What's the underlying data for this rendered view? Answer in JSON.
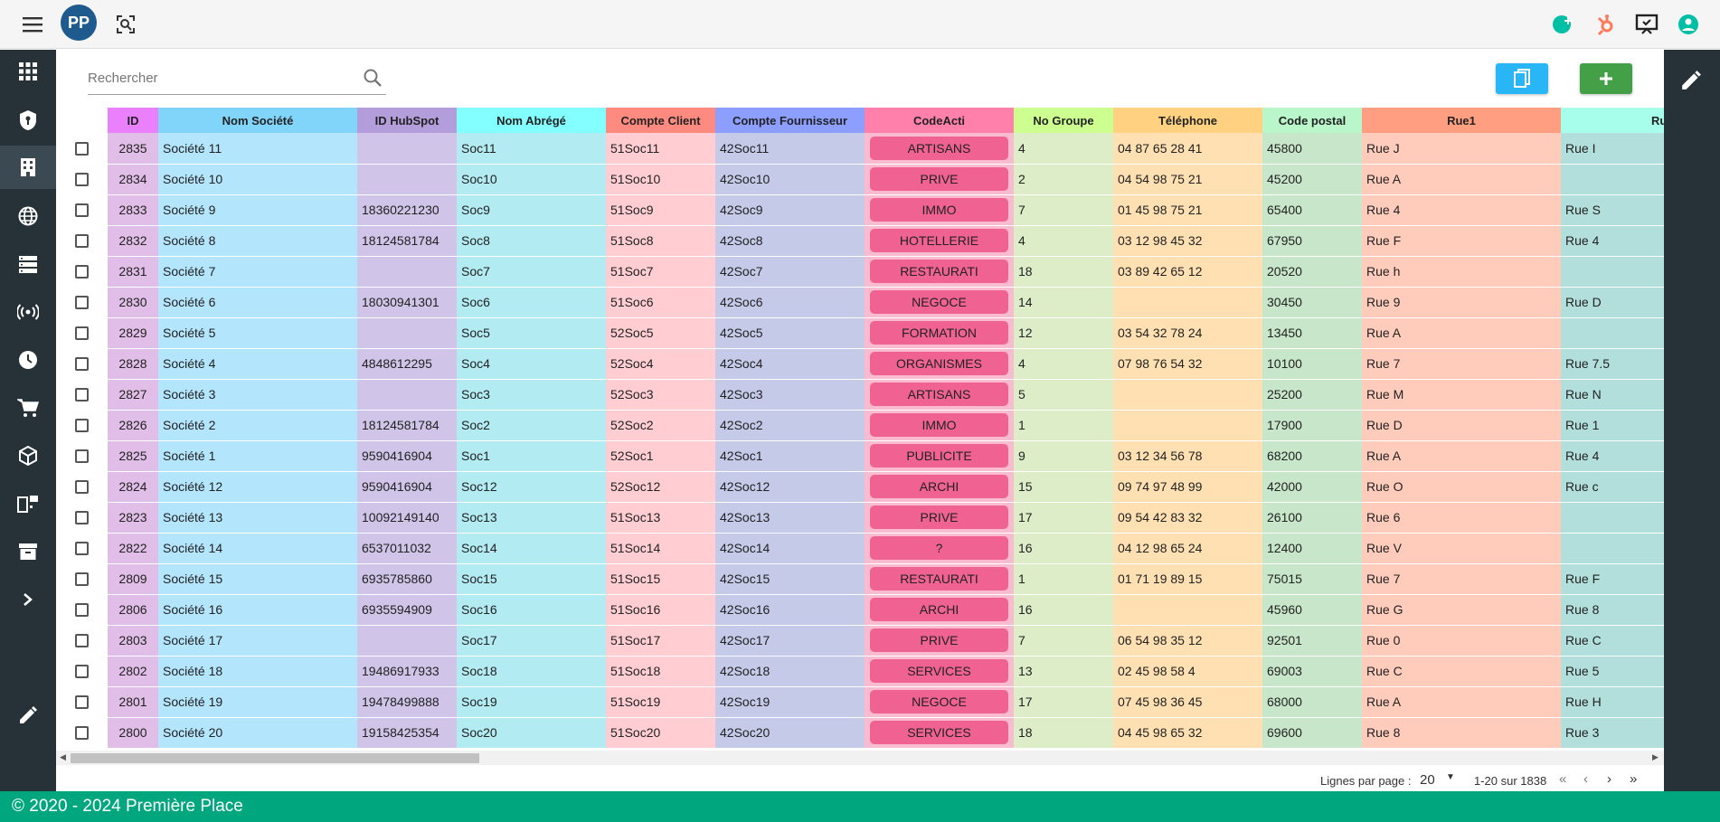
{
  "app": {
    "logo_text": "PP",
    "search_placeholder": "Rechercher"
  },
  "colors": {
    "sidebar": "#263238",
    "footer": "#00a67e",
    "copy_button": "#29b6f6",
    "add_button": "#43a047",
    "code_pill": "#f06292"
  },
  "topbar_icons": [
    "menu-icon",
    "logo",
    "screen-search-icon",
    "chat-add-icon",
    "hubspot-icon",
    "presentation-icon",
    "account-icon"
  ],
  "sidebar_icons": [
    "apps-grid-icon",
    "shield-icon",
    "building-icon",
    "globe-icon",
    "server-icon",
    "broadcast-icon",
    "clock-icon",
    "cart-icon",
    "cube-icon",
    "devices-icon",
    "archive-icon",
    "chevron-right-icon",
    "edit-icon"
  ],
  "table": {
    "headers": [
      "ID",
      "Nom Société",
      "ID HubSpot",
      "Nom Abrégé",
      "Compte Client",
      "Compte Fournisseur",
      "CodeActi",
      "No Groupe",
      "Téléphone",
      "Code postal",
      "Rue1",
      "Ru"
    ],
    "header_colors": [
      "#ea80fc",
      "#81d4fa",
      "#b39ddb",
      "#84ffff",
      "#ff8a80",
      "#8c9eff",
      "#ff80ab",
      "#ccff90",
      "#ffd180",
      "#b9f6ca",
      "#ff9e80",
      "#a7ffeb"
    ],
    "cell_colors": [
      "#e1bee7",
      "#b3e5fc",
      "#d1c4e9",
      "#b2ebf2",
      "#ffcdd2",
      "#c5cae9",
      "#f8bbd0",
      "#dcedc8",
      "#ffe0b2",
      "#c8e6c9",
      "#ffccbc",
      "#b2dfdb"
    ],
    "rows": [
      [
        "2835",
        "Société 11",
        "",
        "Soc11",
        "51Soc11",
        "42Soc11",
        "ARTISANS",
        "4",
        "04 87 65 28 41",
        "45800",
        "Rue J",
        "Rue I"
      ],
      [
        "2834",
        "Société 10",
        "",
        "Soc10",
        "51Soc10",
        "42Soc10",
        "PRIVE",
        "2",
        "04 54 98 75 21",
        "45200",
        "Rue A",
        ""
      ],
      [
        "2833",
        "Société 9",
        "18360221230",
        "Soc9",
        "51Soc9",
        "42Soc9",
        "IMMO",
        "7",
        "01 45 98 75 21",
        "65400",
        "Rue 4",
        "Rue S"
      ],
      [
        "2832",
        "Société 8",
        "18124581784",
        "Soc8",
        "51Soc8",
        "42Soc8",
        "HOTELLERIE",
        "4",
        "03 12 98 45 32",
        "67950",
        "Rue F",
        "Rue 4"
      ],
      [
        "2831",
        "Société 7",
        "",
        "Soc7",
        "51Soc7",
        "42Soc7",
        "RESTAURATI",
        "18",
        "03 89 42 65 12",
        "20520",
        "Rue h",
        ""
      ],
      [
        "2830",
        "Société 6",
        "18030941301",
        "Soc6",
        "51Soc6",
        "42Soc6",
        "NEGOCE",
        "14",
        "",
        "30450",
        "Rue 9",
        "Rue D"
      ],
      [
        "2829",
        "Société 5",
        "",
        "Soc5",
        "52Soc5",
        "42Soc5",
        "FORMATION",
        "12",
        "03 54 32 78 24",
        "13450",
        "Rue A",
        ""
      ],
      [
        "2828",
        "Société 4",
        "4848612295",
        "Soc4",
        "52Soc4",
        "42Soc4",
        "ORGANISMES",
        "4",
        "07 98 76 54 32",
        "10100",
        "Rue 7",
        "Rue 7.5"
      ],
      [
        "2827",
        "Société 3",
        "",
        "Soc3",
        "52Soc3",
        "42Soc3",
        "ARTISANS",
        "5",
        "",
        "25200",
        "Rue M",
        "Rue N"
      ],
      [
        "2826",
        "Société 2",
        "18124581784",
        "Soc2",
        "52Soc2",
        "42Soc2",
        "IMMO",
        "1",
        "",
        "17900",
        "Rue D",
        "Rue 1"
      ],
      [
        "2825",
        "Société 1",
        "9590416904",
        "Soc1",
        "52Soc1",
        "42Soc1",
        "PUBLICITE",
        "9",
        "03 12 34 56 78",
        "68200",
        "Rue A",
        "Rue 4"
      ],
      [
        "2824",
        "Société 12",
        "9590416904",
        "Soc12",
        "52Soc12",
        "42Soc12",
        "ARCHI",
        "15",
        "09 74 97 48 99",
        "42000",
        "Rue O",
        "Rue c"
      ],
      [
        "2823",
        "Société 13",
        "10092149140",
        "Soc13",
        "51Soc13",
        "42Soc13",
        "PRIVE",
        "17",
        "09 54 42 83 32",
        "26100",
        "Rue 6",
        ""
      ],
      [
        "2822",
        "Société 14",
        "6537011032",
        "Soc14",
        "51Soc14",
        "42Soc14",
        "?",
        "16",
        "04 12 98 65 24",
        "12400",
        "Rue V",
        ""
      ],
      [
        "2809",
        "Société 15",
        "6935785860",
        "Soc15",
        "51Soc15",
        "42Soc15",
        "RESTAURATI",
        "1",
        "01 71 19 89 15",
        "75015",
        "Rue 7",
        "Rue F"
      ],
      [
        "2806",
        "Société 16",
        "6935594909",
        "Soc16",
        "51Soc16",
        "42Soc16",
        "ARCHI",
        "16",
        "",
        "45960",
        "Rue G",
        "Rue 8"
      ],
      [
        "2803",
        "Société 17",
        "",
        "Soc17",
        "51Soc17",
        "42Soc17",
        "PRIVE",
        "7",
        "06 54 98 35 12",
        "92501",
        "Rue 0",
        "Rue C"
      ],
      [
        "2802",
        "Société 18",
        "19486917933",
        "Soc18",
        "51Soc18",
        "42Soc18",
        "SERVICES",
        "13",
        "02 45 98 58 4",
        "69003",
        "Rue C",
        "Rue 5"
      ],
      [
        "2801",
        "Société 19",
        "19478499888",
        "Soc19",
        "51Soc19",
        "42Soc19",
        "NEGOCE",
        "17",
        "07 45 98 36 45",
        "68000",
        "Rue A",
        "Rue H"
      ],
      [
        "2800",
        "Société 20",
        "19158425354",
        "Soc20",
        "51Soc20",
        "42Soc20",
        "SERVICES",
        "18",
        "04 45 98 65 32",
        "69600",
        "Rue 8",
        "Rue 3"
      ]
    ]
  },
  "pagination": {
    "rows_per_page_label": "Lignes par page :",
    "rows_per_page": "20",
    "range": "1-20 sur 1838"
  },
  "footer": {
    "text": "© 2020 - 2024 Première Place"
  }
}
